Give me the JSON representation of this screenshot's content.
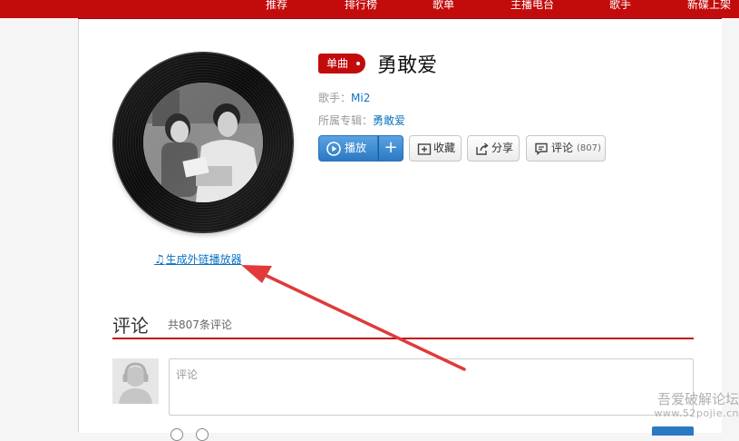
{
  "nav": {
    "items": [
      "推荐",
      "排行榜",
      "歌单",
      "主播电台",
      "歌手",
      "新碟上架"
    ]
  },
  "song": {
    "badge": "单曲",
    "title": "勇敢爱",
    "singer_label": "歌手：",
    "singer": "Mi2",
    "album_label": "所属专辑：",
    "album": "勇敢爱"
  },
  "actions": {
    "play": "播放",
    "add": "+",
    "collect": "收藏",
    "share": "分享",
    "comment": "评论",
    "comment_count": "(807)"
  },
  "link": {
    "generate_player": "生成外链播放器"
  },
  "comments": {
    "title": "评论",
    "count_text": "共807条评论",
    "placeholder": "评论"
  },
  "watermark": {
    "name": "吾爱破解论坛",
    "url": "www.52pojie.cn"
  },
  "colors": {
    "brand_red": "#c20c0c",
    "link_blue": "#0c73c2",
    "play_blue": "#2b79c3",
    "annotation_red": "#e03a3a"
  },
  "icons": {
    "play": "play-circle-icon",
    "collect": "folder-plus-icon",
    "share": "share-icon",
    "comment": "comment-icon",
    "music_note": "music-note-icon"
  }
}
